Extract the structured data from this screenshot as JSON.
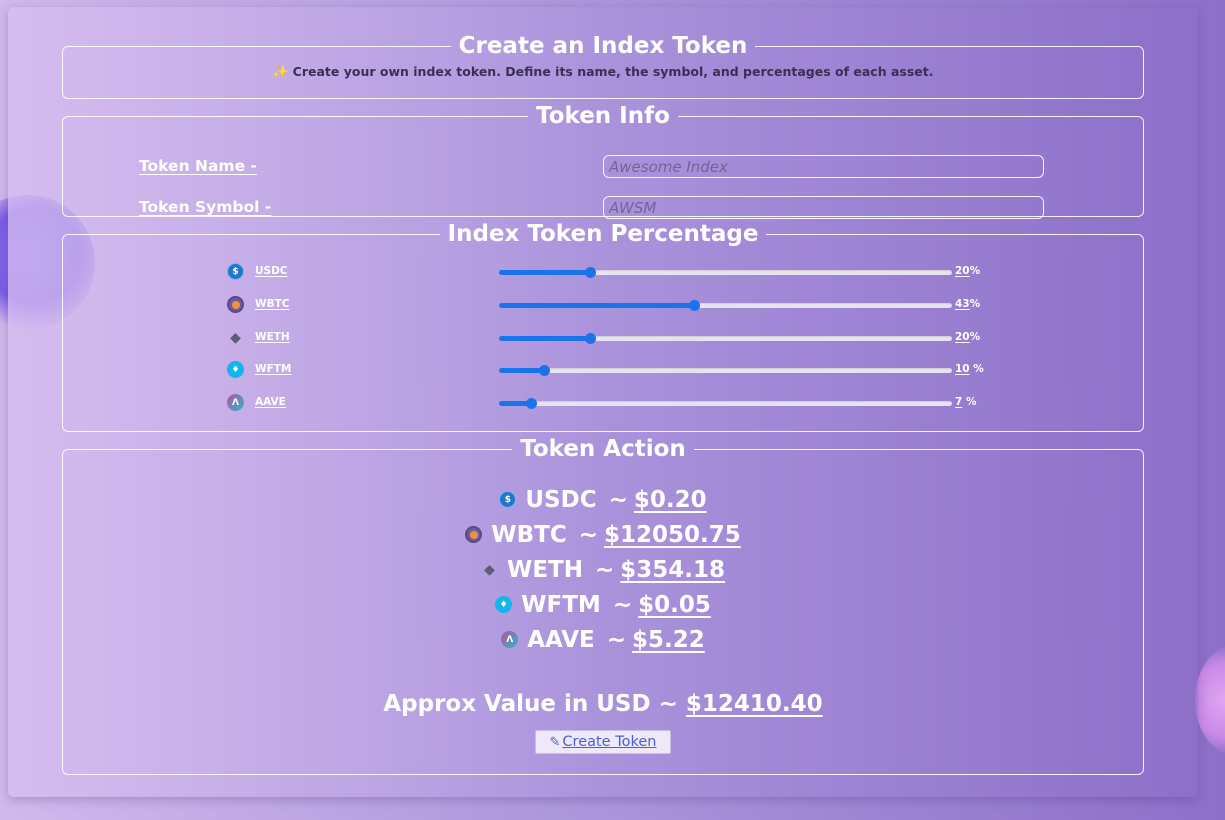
{
  "header": {
    "title": "Create an Index Token",
    "description": "Create your own index token. Define its name, the symbol, and percentages of each asset."
  },
  "token_info": {
    "title": "Token Info",
    "name_label": "Token Name -",
    "name_placeholder": "Awesome Index",
    "symbol_label": "Token Symbol -",
    "symbol_placeholder": "AWSM"
  },
  "percentages": {
    "title": "Index Token Percentage",
    "assets": [
      {
        "symbol": "USDC",
        "percent": 20,
        "percent_text": "20",
        "unit": "%"
      },
      {
        "symbol": "WBTC",
        "percent": 43,
        "percent_text": "43",
        "unit": "%"
      },
      {
        "symbol": "WETH",
        "percent": 20,
        "percent_text": "20",
        "unit": "%"
      },
      {
        "symbol": "WFTM",
        "percent": 10,
        "percent_text": "10",
        "unit": " %"
      },
      {
        "symbol": "AAVE",
        "percent": 7,
        "percent_text": "7",
        "unit": " %"
      }
    ],
    "slider_color": "#1a73e8"
  },
  "action": {
    "title": "Token Action",
    "separator": "~",
    "items": [
      {
        "symbol": "USDC",
        "price": "$0.20",
        "icon": "usdc-coin-icon"
      },
      {
        "symbol": "WBTC",
        "price": "$12050.75",
        "icon": "wbtc-coin-icon"
      },
      {
        "symbol": "WETH",
        "price": "$354.18",
        "icon": "weth-coin-icon"
      },
      {
        "symbol": "WFTM",
        "price": "$0.05",
        "icon": "wftm-coin-icon"
      },
      {
        "symbol": "AAVE",
        "price": "$5.22",
        "icon": "aave-coin-icon"
      }
    ],
    "approx_label": "Approx Value in USD ~",
    "approx_value": "$12410.40",
    "create_button": "Create Token"
  }
}
